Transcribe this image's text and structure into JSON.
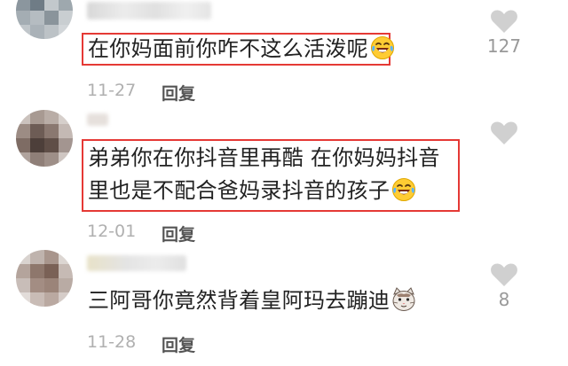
{
  "comments": [
    {
      "text_lines": [
        "在你妈面前你咋不这么活泼呢"
      ],
      "emoji": "laughing-tears-emoji",
      "date": "11-27",
      "reply_label": "回复",
      "likes": "127",
      "highlighted": true
    },
    {
      "text_lines": [
        "弟弟你在你抖音里再酷 在你妈妈抖音",
        "里也是不配合爸妈录抖音的孩子"
      ],
      "emoji": "laughing-tears-emoji",
      "date": "12-01",
      "reply_label": "回复",
      "likes": "",
      "highlighted": true
    },
    {
      "text_lines": [
        "三阿哥你竟然背着皇阿玛去蹦迪"
      ],
      "emoji": "cat-face-emoji",
      "date": "11-28",
      "reply_label": "回复",
      "likes": "8",
      "highlighted": false
    }
  ],
  "colors": {
    "highlight_border": "#e53935",
    "date_text": "#b0b0b0",
    "reply_text": "#555555",
    "heart": "#d0d0d0"
  },
  "icons": {
    "like": "heart-icon"
  }
}
